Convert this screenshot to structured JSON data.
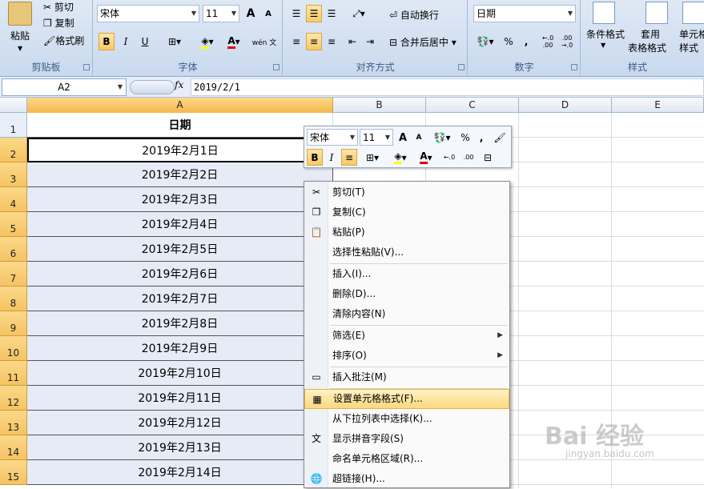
{
  "ribbon": {
    "clipboard": {
      "paste": "粘贴",
      "cut": "剪切",
      "copy": "复制",
      "format_painter": "格式刷",
      "label": "剪贴板"
    },
    "font": {
      "name": "宋体",
      "size": "11",
      "bold": "B",
      "italic": "I",
      "underline": "U",
      "grow": "A",
      "shrink": "A",
      "font_color": "A",
      "phonetic": "wén 文",
      "label": "字体"
    },
    "alignment": {
      "wrap_text": "自动换行",
      "merge_center": "合并后居中",
      "label": "对齐方式"
    },
    "number": {
      "format": "日期",
      "percent": "%",
      "comma": ",",
      "inc_decimal": "←.0 .00",
      "dec_decimal": ".00 →.0",
      "label": "数字"
    },
    "styles": {
      "conditional": "条件格式",
      "table_format_1": "套用",
      "table_format_2": "表格格式",
      "cell_styles_1": "单元格",
      "cell_styles_2": "样式",
      "label": "样式"
    }
  },
  "formula_bar": {
    "name_box": "A2",
    "fx": "fx",
    "value": "2019/2/1"
  },
  "columns": [
    "A",
    "B",
    "C",
    "D",
    "E"
  ],
  "rows": [
    {
      "num": "1",
      "value": "日期"
    },
    {
      "num": "2",
      "value": "2019年2月1日"
    },
    {
      "num": "3",
      "value": "2019年2月2日"
    },
    {
      "num": "4",
      "value": "2019年2月3日"
    },
    {
      "num": "5",
      "value": "2019年2月4日"
    },
    {
      "num": "6",
      "value": "2019年2月5日"
    },
    {
      "num": "7",
      "value": "2019年2月6日"
    },
    {
      "num": "8",
      "value": "2019年2月7日"
    },
    {
      "num": "9",
      "value": "2019年2月8日"
    },
    {
      "num": "10",
      "value": "2019年2月9日"
    },
    {
      "num": "11",
      "value": "2019年2月10日"
    },
    {
      "num": "12",
      "value": "2019年2月11日"
    },
    {
      "num": "13",
      "value": "2019年2月12日"
    },
    {
      "num": "14",
      "value": "2019年2月13日"
    },
    {
      "num": "15",
      "value": "2019年2月14日"
    }
  ],
  "mini_toolbar": {
    "font": "宋体",
    "size": "11",
    "percent": "%",
    "comma": ",",
    "bold": "B",
    "italic": "I",
    "font_color": "A"
  },
  "context_menu": [
    {
      "label": "剪切(T)",
      "icon": "scissors-icon",
      "glyph": "✂"
    },
    {
      "label": "复制(C)",
      "icon": "copy-icon",
      "glyph": "❐"
    },
    {
      "label": "粘贴(P)",
      "icon": "paste-icon",
      "glyph": "📋"
    },
    {
      "label": "选择性粘贴(V)...",
      "icon": "",
      "glyph": ""
    },
    {
      "label": "插入(I)...",
      "icon": "",
      "glyph": ""
    },
    {
      "label": "删除(D)...",
      "icon": "",
      "glyph": ""
    },
    {
      "label": "清除内容(N)",
      "icon": "",
      "glyph": ""
    },
    {
      "label": "筛选(E)",
      "icon": "",
      "glyph": "",
      "submenu": true
    },
    {
      "label": "排序(O)",
      "icon": "",
      "glyph": "",
      "submenu": true
    },
    {
      "label": "插入批注(M)",
      "icon": "comment-icon",
      "glyph": "▭"
    },
    {
      "label": "设置单元格格式(F)...",
      "icon": "format-cells-icon",
      "glyph": "▦",
      "highlighted": true
    },
    {
      "label": "从下拉列表中选择(K)...",
      "icon": "",
      "glyph": ""
    },
    {
      "label": "显示拼音字段(S)",
      "icon": "phonetic-icon",
      "glyph": "文"
    },
    {
      "label": "命名单元格区域(R)...",
      "icon": "",
      "glyph": ""
    },
    {
      "label": "超链接(H)...",
      "icon": "hyperlink-icon",
      "glyph": "🌐"
    }
  ],
  "watermark": {
    "brand": "Bai 经验",
    "url": "jingyan.baidu.com"
  }
}
